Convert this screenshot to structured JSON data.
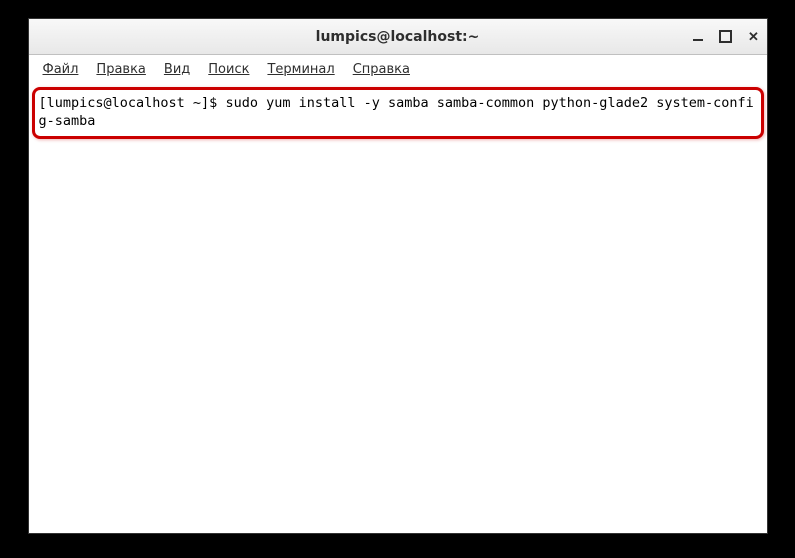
{
  "window": {
    "title": "lumpics@localhost:~"
  },
  "menubar": {
    "items": [
      {
        "label": "Файл"
      },
      {
        "label": "Правка"
      },
      {
        "label": "Вид"
      },
      {
        "label": "Поиск"
      },
      {
        "label": "Терминал"
      },
      {
        "label": "Справка"
      }
    ]
  },
  "terminal": {
    "prompt": "[lumpics@localhost ~]$ ",
    "command": "sudo yum install -y samba samba-common python-glade2 system-config-samba"
  },
  "highlight": {
    "color": "#cb0000"
  }
}
